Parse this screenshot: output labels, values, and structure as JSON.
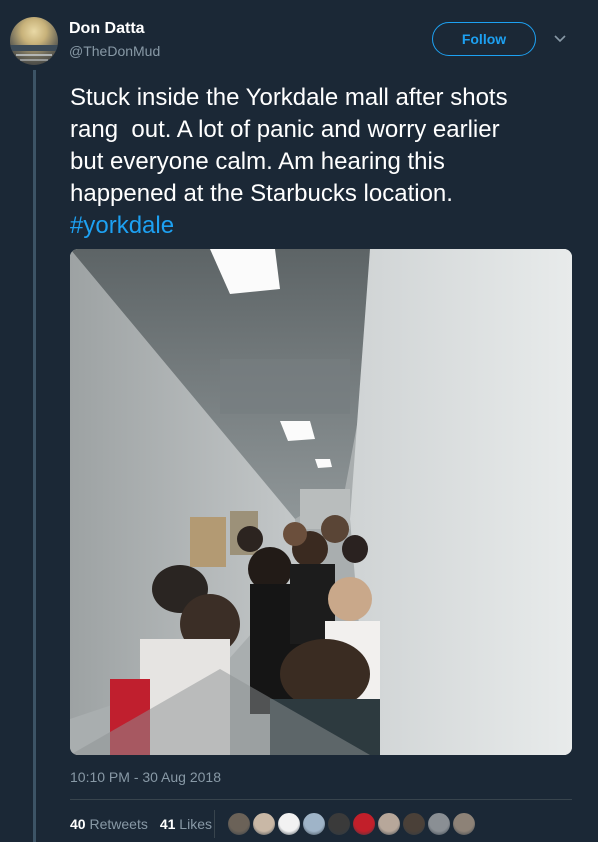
{
  "author": {
    "name": "Don Datta",
    "handle": "@TheDonMud"
  },
  "follow_label": "Follow",
  "tweet": {
    "text": "Stuck inside the Yorkdale mall after shots\nrang  out. A lot of panic and worry earlier\nbut everyone calm. Am hearing this\nhappened at the Starbucks location.\n",
    "hashtag": "#yorkdale"
  },
  "timestamp": "10:10 PM - 30 Aug 2018",
  "stats": {
    "retweets_count": "40",
    "retweets_label": "Retweets",
    "likes_count": "41",
    "likes_label": "Likes"
  },
  "likers": [
    {
      "color": "#6b6258"
    },
    {
      "color": "#c9b8a6"
    },
    {
      "color": "#f2f2f2"
    },
    {
      "color": "#9fb4c8"
    },
    {
      "color": "#3a3a3a"
    },
    {
      "color": "#c21f2a"
    },
    {
      "color": "#b7a79a"
    },
    {
      "color": "#4a4038"
    },
    {
      "color": "#8a8f94"
    },
    {
      "color": "#8d8277"
    }
  ],
  "colors": {
    "background": "#1b2836",
    "accent": "#1da1f2",
    "muted_text": "#8899a6"
  }
}
